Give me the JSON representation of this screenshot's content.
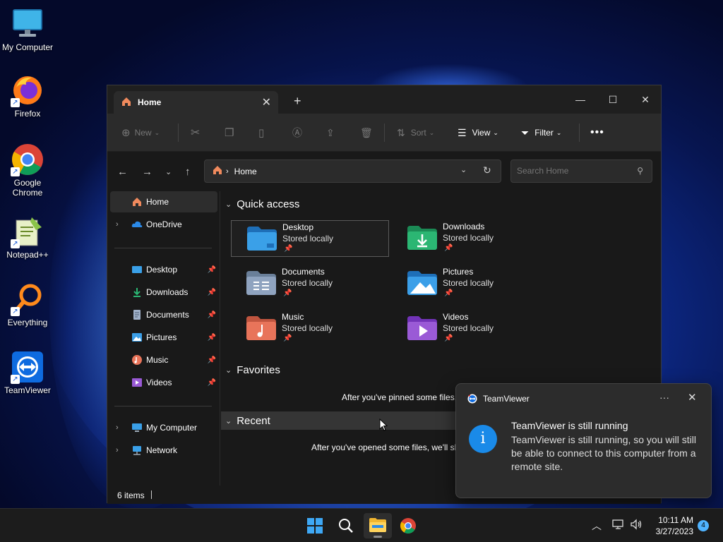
{
  "desktop": {
    "icons": [
      {
        "label": "My Computer"
      },
      {
        "label": "Firefox"
      },
      {
        "label": "Google Chrome"
      },
      {
        "label": "Notepad++"
      },
      {
        "label": "Everything"
      },
      {
        "label": "TeamViewer"
      }
    ]
  },
  "explorer": {
    "tab_title": "Home",
    "toolbar": {
      "new_label": "New",
      "sort_label": "Sort",
      "view_label": "View",
      "filter_label": "Filter"
    },
    "address": "Home",
    "search_placeholder": "Search Home",
    "sidebar": {
      "home": "Home",
      "onedrive": "OneDrive",
      "pinned": [
        "Desktop",
        "Downloads",
        "Documents",
        "Pictures",
        "Music",
        "Videos"
      ],
      "my_computer": "My Computer",
      "network": "Network"
    },
    "quick_access": {
      "heading": "Quick access",
      "items": [
        {
          "name": "Desktop",
          "status": "Stored locally",
          "color": "#3aa0e8"
        },
        {
          "name": "Downloads",
          "status": "Stored locally",
          "color": "#2bb673"
        },
        {
          "name": "Documents",
          "status": "Stored locally",
          "color": "#8fa3bf"
        },
        {
          "name": "Pictures",
          "status": "Stored locally",
          "color": "#3b9fe8"
        },
        {
          "name": "Music",
          "status": "Stored locally",
          "color": "#e8745a"
        },
        {
          "name": "Videos",
          "status": "Stored locally",
          "color": "#9a5ad6"
        }
      ]
    },
    "favorites": {
      "heading": "Favorites",
      "empty": "After you've pinned some files,"
    },
    "recent": {
      "heading": "Recent",
      "empty": "After you've opened some files, we'll sh"
    },
    "status": {
      "item_count": "6 items"
    }
  },
  "toast": {
    "app_name": "TeamViewer",
    "title": "TeamViewer is still running",
    "body": "TeamViewer is still running, so you will still be able to connect to this computer from a remote site."
  },
  "taskbar": {
    "time": "10:11 AM",
    "date": "3/27/2023",
    "notification_count": "4"
  }
}
